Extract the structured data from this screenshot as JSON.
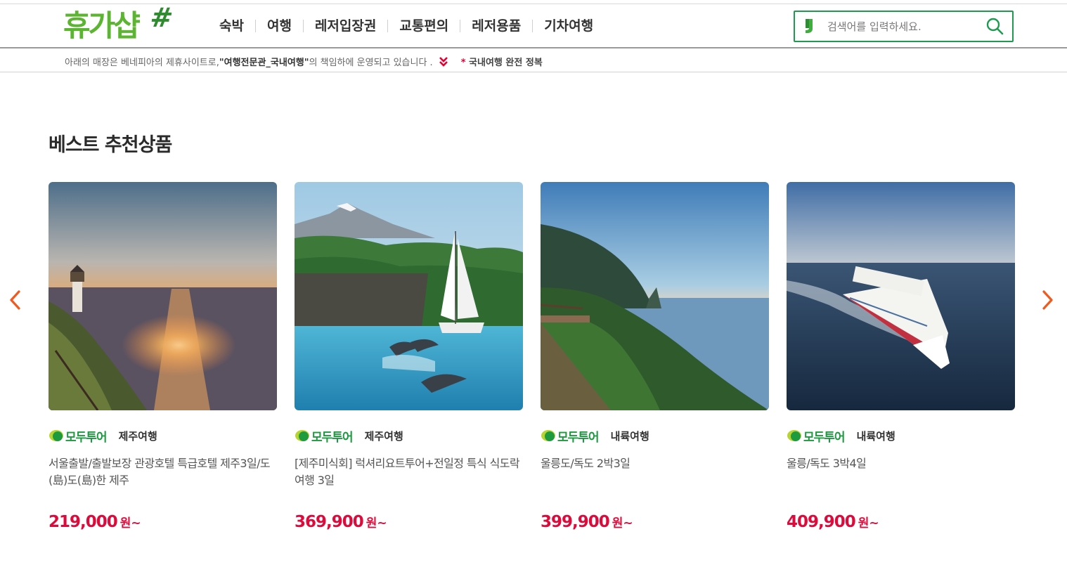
{
  "header": {
    "logo_text": "휴가샵",
    "logo_mark": "#",
    "nav": [
      {
        "label": "숙박"
      },
      {
        "label": "여행"
      },
      {
        "label": "레저입장권"
      },
      {
        "label": "교통편의"
      },
      {
        "label": "레저용품"
      },
      {
        "label": "기차여행"
      }
    ],
    "search": {
      "placeholder": "검색어를 입력하세요.",
      "icon": "search-icon"
    }
  },
  "notice": {
    "prefix": "아래의 매장은 베네피아의 제휴사이트로, ",
    "partner": "\"여행전문관_국내여행\"",
    "suffix": " 의 책임하에 운영되고 있습니다 .",
    "right_star": "*",
    "right_text": " 국내여행 완전 정복"
  },
  "section": {
    "title": "베스트 추천상품"
  },
  "products": [
    {
      "brand": "모두투어",
      "category": "제주여행",
      "title": "서울출발/출발보장 관광호텔 특급호텔 제주3일/도(島)도(島)한 제주",
      "price": "219,000",
      "unit": "원~"
    },
    {
      "brand": "모두투어",
      "category": "제주여행",
      "title": "[제주미식회] 럭셔리요트투어+전일정 특식 식도락여행 3일",
      "price": "369,900",
      "unit": "원~"
    },
    {
      "brand": "모두투어",
      "category": "내륙여행",
      "title": "울릉도/독도 2박3일",
      "price": "399,900",
      "unit": "원~"
    },
    {
      "brand": "모두투어",
      "category": "내륙여행",
      "title": "울릉/독도 3박4일",
      "price": "409,900",
      "unit": "원~"
    }
  ],
  "colors": {
    "brand_green": "#5cb531",
    "search_border": "#1e9b50",
    "price_red": "#dd0b3c",
    "arrow_orange": "#f05a1e"
  }
}
